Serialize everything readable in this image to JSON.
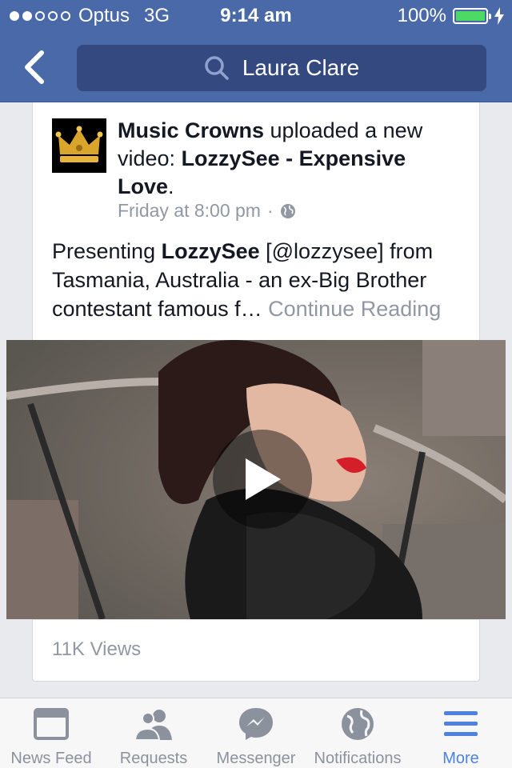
{
  "status_bar": {
    "carrier": "Optus",
    "network": "3G",
    "time": "9:14 am",
    "battery": "100%",
    "signal_bars_filled": 2,
    "signal_bars_total": 5
  },
  "nav": {
    "back_icon": "chevron-left-icon",
    "search_icon": "search-icon",
    "search_text": "Laura Clare"
  },
  "post": {
    "author": "Music Crowns",
    "action": " uploaded a new video: ",
    "video_title": "LozzySee - Expensive Love",
    "title_end": ".",
    "timestamp": "Friday at 8:00 pm",
    "separator": "·",
    "privacy_icon": "globe-icon",
    "text_prefix": "Presenting ",
    "text_bold": "LozzySee",
    "text_rest": " [@lozzysee] from Tasmania, Australia - an ex-Big Brother contestant famous f… ",
    "continue_label": "Continue Reading",
    "views": "11K Views",
    "avatar_icon": "crown-icon",
    "play_icon": "play-icon"
  },
  "tabs": [
    {
      "label": "News Feed",
      "icon": "news-feed-icon",
      "active": false
    },
    {
      "label": "Requests",
      "icon": "requests-icon",
      "active": false
    },
    {
      "label": "Messenger",
      "icon": "messenger-icon",
      "active": false
    },
    {
      "label": "Notifications",
      "icon": "globe-icon",
      "active": false
    },
    {
      "label": "More",
      "icon": "menu-icon",
      "active": true
    }
  ],
  "colors": {
    "brand_blue": "#4a69a8",
    "active_tab": "#4f82de",
    "battery_green": "#4cd964"
  }
}
